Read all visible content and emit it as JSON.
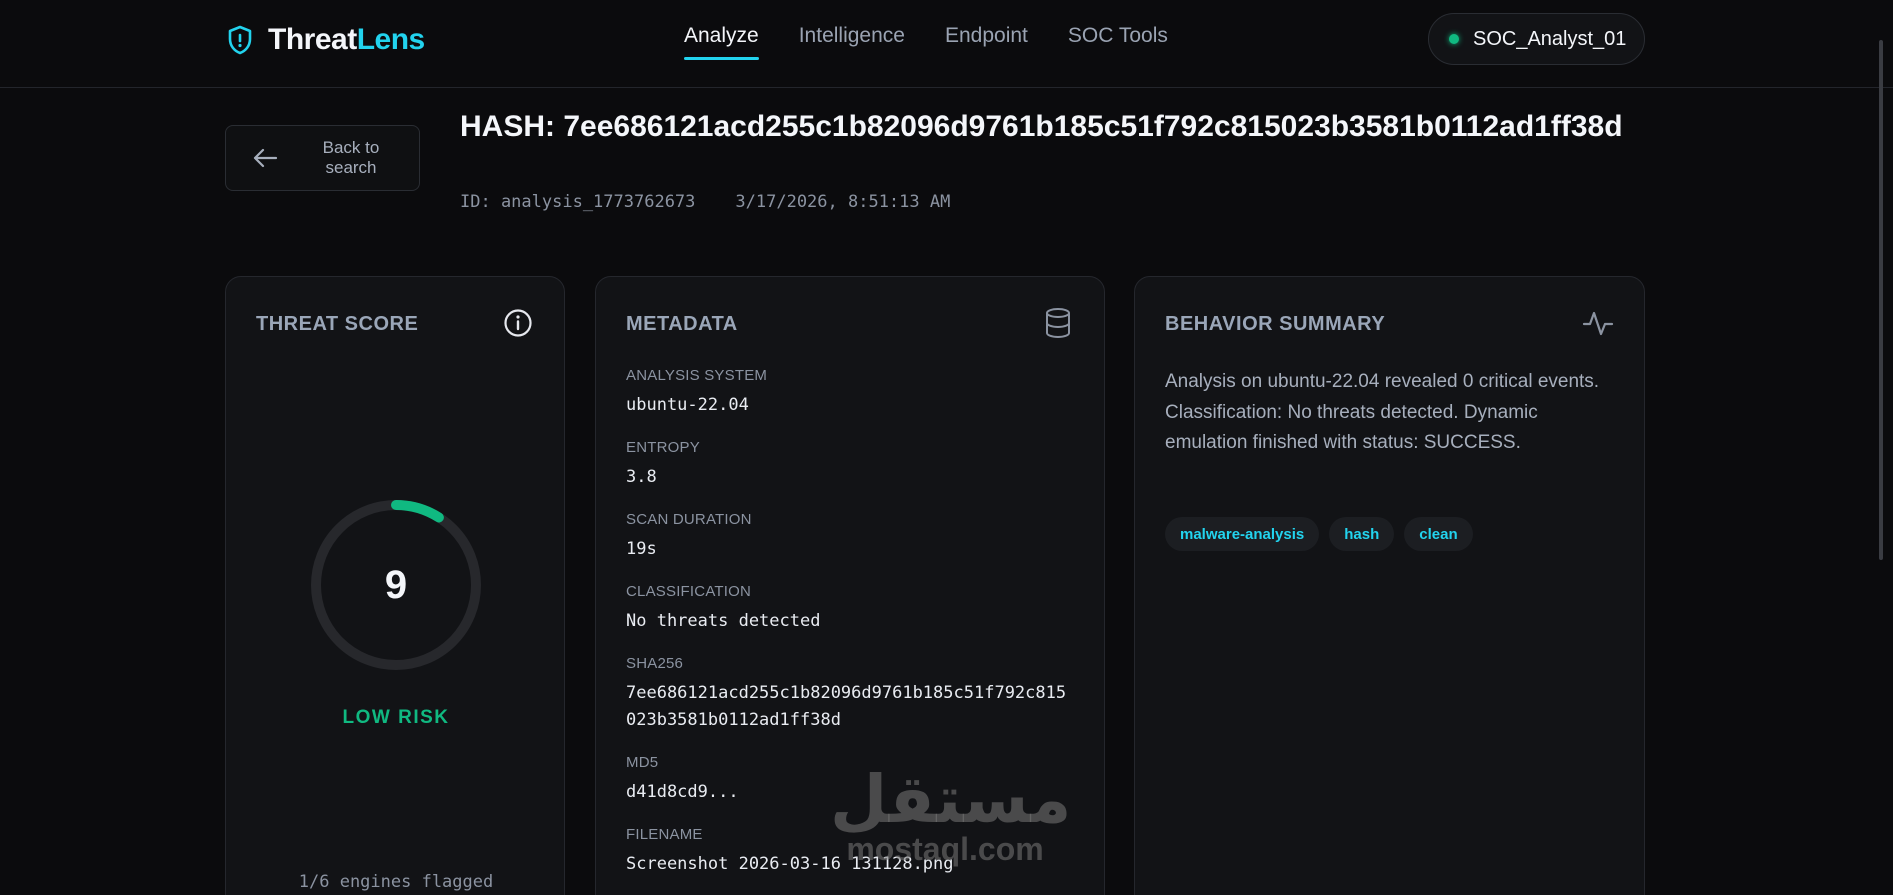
{
  "header": {
    "logo_primary": "Threat",
    "logo_accent": "Lens",
    "nav": [
      {
        "label": "Analyze",
        "active": true
      },
      {
        "label": "Intelligence",
        "active": false
      },
      {
        "label": "Endpoint",
        "active": false
      },
      {
        "label": "SOC Tools",
        "active": false
      }
    ],
    "user": {
      "name": "SOC_Analyst_01",
      "status_color": "#10b981"
    }
  },
  "title_area": {
    "back_label": "Back to search",
    "hash_title": "HASH: 7ee686121acd255c1b82096d9761b185c51f792c815023b3581b0112ad1ff38d",
    "analysis_id": "ID: analysis_1773762673",
    "timestamp": "3/17/2026, 8:51:13 AM"
  },
  "threat_card": {
    "title": "THREAT SCORE",
    "score": "9",
    "score_fraction": 0.09,
    "risk_label": "LOW RISK",
    "engines": "1/6 engines flagged",
    "accent_color": "#10b981"
  },
  "metadata_card": {
    "title": "METADATA",
    "fields": [
      {
        "label": "ANALYSIS SYSTEM",
        "value": "ubuntu-22.04"
      },
      {
        "label": "ENTROPY",
        "value": "3.8"
      },
      {
        "label": "SCAN DURATION",
        "value": "19s"
      },
      {
        "label": "CLASSIFICATION",
        "value": "No threats detected"
      },
      {
        "label": "SHA256",
        "value": "7ee686121acd255c1b82096d9761b185c51f792c815023b3581b0112ad1ff38d"
      },
      {
        "label": "MD5",
        "value": "d41d8cd9..."
      },
      {
        "label": "FILENAME",
        "value": "Screenshot 2026-03-16 131128.png"
      }
    ]
  },
  "behavior_card": {
    "title": "BEHAVIOR SUMMARY",
    "summary": "Analysis on ubuntu-22.04 revealed 0 critical events. Classification: No threats detected. Dynamic emulation finished with status: SUCCESS.",
    "tags": [
      "malware-analysis",
      "hash",
      "clean"
    ]
  },
  "watermark": {
    "arabic": "مستقل",
    "latin": "mostaql.com"
  }
}
